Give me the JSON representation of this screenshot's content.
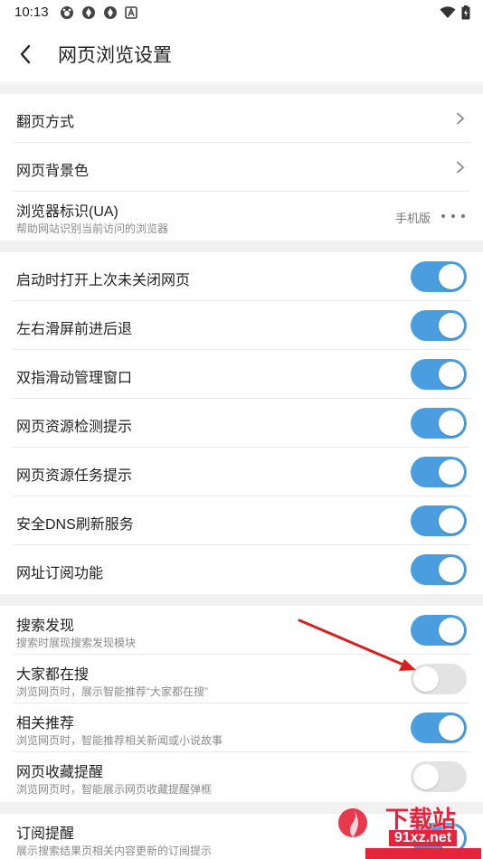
{
  "status_bar": {
    "time": "10:13",
    "left_icons": [
      "paw-icon",
      "aperture-icon",
      "aperture-icon",
      "a-badge-icon"
    ],
    "right_icons": [
      "wifi-icon",
      "battery-charging-icon"
    ]
  },
  "header": {
    "title": "网页浏览设置",
    "back_icon": "back-arrow-icon"
  },
  "sections": {
    "basic": {
      "page_turn": "翻页方式",
      "bg_color": "网页背景色",
      "ua_title": "浏览器标识(UA)",
      "ua_sub": "帮助网站识别当前访问的浏览器",
      "ua_value": "手机版"
    },
    "toggles": [
      {
        "label": "启动时打开上次未关闭网页",
        "on": true
      },
      {
        "label": "左右滑屏前进后退",
        "on": true
      },
      {
        "label": "双指滑动管理窗口",
        "on": true
      },
      {
        "label": "网页资源检测提示",
        "on": true
      },
      {
        "label": "网页资源任务提示",
        "on": true
      },
      {
        "label": "安全DNS刷新服务",
        "on": true
      },
      {
        "label": "网址订阅功能",
        "on": true
      }
    ],
    "discovery": [
      {
        "label": "搜索发现",
        "sub": "搜索时展现搜索发现模块",
        "on": true
      },
      {
        "label": "大家都在搜",
        "sub": "浏览网页时，展示智能推荐“大家都在搜”",
        "on": false
      },
      {
        "label": "相关推荐",
        "sub": "浏览网页时，智能推荐相关新闻或小说故事",
        "on": true
      },
      {
        "label": "网页收藏提醒",
        "sub": "浏览网页时，智能展示网页收藏提醒弹框",
        "on": false
      }
    ],
    "subscribe": {
      "label": "订阅提醒",
      "sub": "展示搜索结果页相关内容更新的订阅提示",
      "on": true
    }
  },
  "watermark": {
    "brand": "下载站",
    "domain": "91xz.net"
  },
  "colors": {
    "accent": "#4a9ee0",
    "toggle_off": "#e3e3e3",
    "annotation_arrow": "#d9201c",
    "section_gap": "#f1f1f1"
  }
}
